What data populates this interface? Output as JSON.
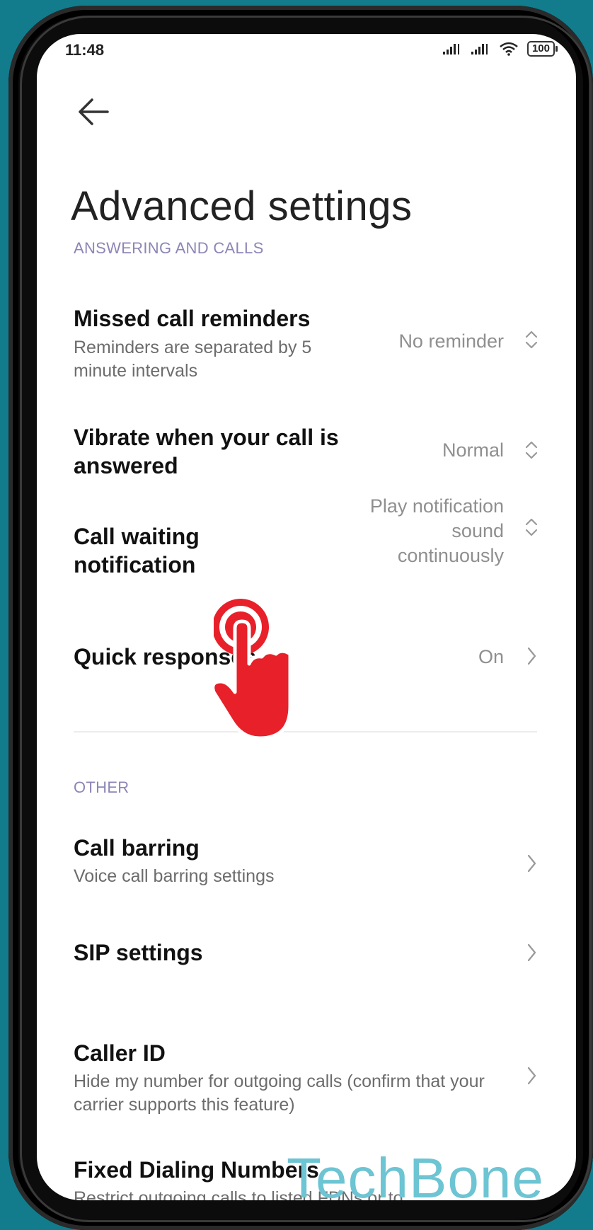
{
  "status_bar": {
    "time": "11:48",
    "battery": "100"
  },
  "page": {
    "title": "Advanced settings"
  },
  "sections": {
    "answering": {
      "header": "ANSWERING AND CALLS",
      "items": [
        {
          "title": "Missed call reminders",
          "subtitle": "Reminders are separated by 5 minute intervals",
          "value": "No reminder"
        },
        {
          "title": "Vibrate when your call is answered",
          "value": "Normal"
        },
        {
          "title": "Call waiting notification",
          "value": "Play notification sound continuously"
        },
        {
          "title": "Quick responses",
          "value": "On"
        }
      ]
    },
    "other": {
      "header": "OTHER",
      "items": [
        {
          "title": "Call barring",
          "subtitle": "Voice call barring settings"
        },
        {
          "title": "SIP settings"
        },
        {
          "title": "Caller ID",
          "subtitle": "Hide my number for outgoing calls (confirm that your carrier supports this feature)"
        },
        {
          "title": "Fixed Dialing Numbers",
          "subtitle": "Restrict outgoing calls to listed FDNs or to..."
        }
      ]
    }
  },
  "watermark": "TechBone",
  "colors": {
    "accent_header": "#8c86b6",
    "background": "#127c8c",
    "pointer": "#e8202a"
  }
}
